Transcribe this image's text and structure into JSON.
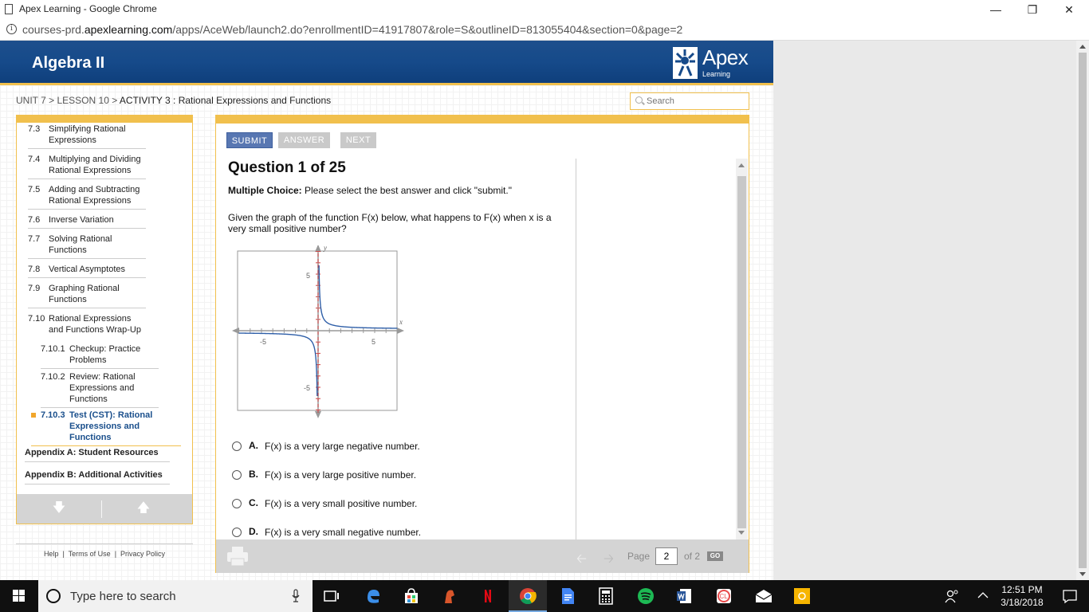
{
  "browser": {
    "window_title": "Apex Learning - Google Chrome",
    "url_prefix": "courses-prd.",
    "url_domain": "apexlearning.com",
    "url_path": "/apps/AceWeb/launch2.do?enrollmentID=41917807&role=S&outlineID=813055404&section=0&page=2"
  },
  "app": {
    "course_title": "Algebra II",
    "logo_name": "Apex",
    "logo_sub": "Learning",
    "search_placeholder": "Search",
    "breadcrumb": {
      "unit": "UNIT 7",
      "sep1": ">",
      "lesson": "LESSON 10",
      "sep2": ">",
      "activity": "ACTIVITY 3 : Rational Expressions and Functions"
    }
  },
  "sidebar": {
    "items": [
      {
        "num": "7.3",
        "label": "Simplifying Rational Expressions"
      },
      {
        "num": "7.4",
        "label": "Multiplying and Dividing Rational Expressions"
      },
      {
        "num": "7.5",
        "label": "Adding and Subtracting Rational Expressions"
      },
      {
        "num": "7.6",
        "label": "Inverse Variation"
      },
      {
        "num": "7.7",
        "label": "Solving Rational Functions"
      },
      {
        "num": "7.8",
        "label": "Vertical Asymptotes"
      },
      {
        "num": "7.9",
        "label": "Graphing Rational Functions"
      },
      {
        "num": "7.10",
        "label": "Rational Expressions and Functions Wrap-Up"
      }
    ],
    "subitems": [
      {
        "num": "7.10.1",
        "label": "Checkup: Practice Problems"
      },
      {
        "num": "7.10.2",
        "label": "Review: Rational Expressions and Functions"
      }
    ],
    "current": {
      "num": "7.10.3",
      "label": "Test (CST): Rational Expressions and Functions"
    },
    "appendices": [
      "Appendix A: Student Resources",
      "Appendix B: Additional Activities"
    ],
    "footer_links": [
      "Help",
      "Terms of Use",
      "Privacy Policy"
    ],
    "footer_sep": "|"
  },
  "question": {
    "buttons": {
      "submit": "SUBMIT",
      "answer": "ANSWER",
      "next": "NEXT"
    },
    "title": "Question 1 of 25",
    "instruction_bold": "Multiple Choice:",
    "instruction_rest": " Please select the best answer and click \"submit.\"",
    "text": "Given the graph of the function F(x) below, what happens to F(x) when x is a very small positive number?",
    "graph": {
      "x_axis_label": "x",
      "y_axis_label": "y",
      "tick_neg5": "-5",
      "tick_pos5": "5"
    },
    "choices": [
      {
        "letter": "A.",
        "text": "F(x) is a very large negative number."
      },
      {
        "letter": "B.",
        "text": "F(x) is a very large positive number."
      },
      {
        "letter": "C.",
        "text": "F(x) is a very small positive number."
      },
      {
        "letter": "D.",
        "text": "F(x) is a very small negative number."
      }
    ],
    "pager": {
      "label": "Page",
      "value": "2",
      "of": "of 2",
      "go": "GO"
    }
  },
  "taskbar": {
    "search_text": "Type here to search",
    "time": "12:51 PM",
    "date": "3/18/2018"
  },
  "colors": {
    "header_blue": "#164a8a",
    "accent_gold": "#f1c04d",
    "submit_blue": "#5877b2",
    "curve_blue": "#2f5fa8",
    "asymptote_red": "#d04040"
  }
}
